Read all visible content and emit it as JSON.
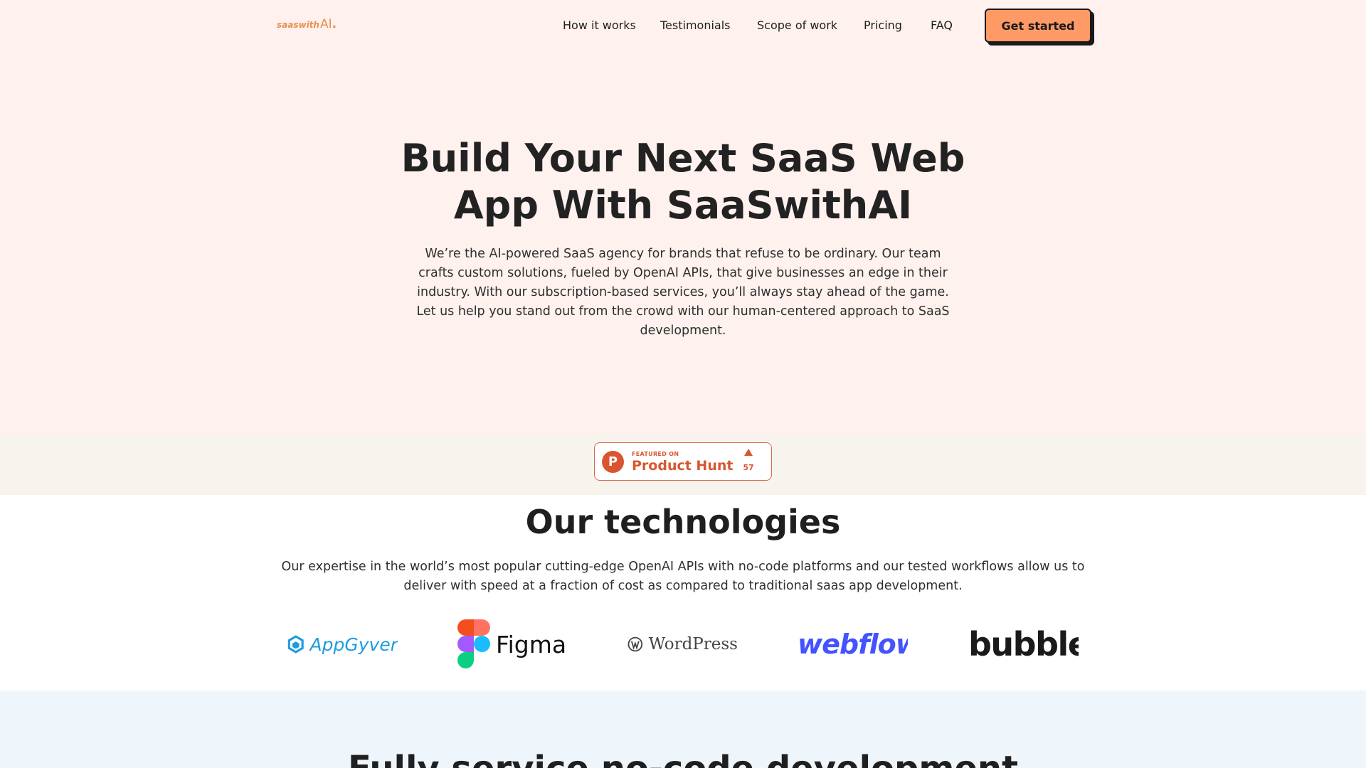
{
  "header": {
    "logo": {
      "small": "saaswith",
      "big": "AI",
      "dot": "."
    },
    "nav": [
      "How it works",
      "Testimonials",
      "Scope of work",
      "Pricing",
      "FAQ"
    ],
    "cta_label": "Get started"
  },
  "hero": {
    "title_line1": "Build Your Next SaaS Web",
    "title_line2": "App With SaaSwithAI",
    "description": "We’re the AI-powered SaaS agency for brands that refuse to be ordinary. Our team crafts custom solutions, fueled by OpenAI APIs, that give businesses an edge in their industry. With our subscription-based services, you’ll always stay ahead of the game. Let us help you stand out from the crowd with our human-centered approach to SaaS development."
  },
  "product_hunt": {
    "featured": "FEATURED ON",
    "name": "Product Hunt",
    "upvotes": "57",
    "color": "#da552f"
  },
  "technologies": {
    "title": "Our technologies",
    "description": "Our expertise in the world’s most popular cutting-edge OpenAI APIs with no-code platforms and our tested workflows allow us to deliver with speed at a fraction of cost as compared to traditional saas app development.",
    "logos": [
      "AppGyver",
      "Figma",
      "WordPress",
      "webflow",
      "bubble"
    ]
  },
  "next_section": {
    "title": "Fully service no-code development"
  },
  "colors": {
    "accent": "#ff9a66",
    "hero_bg": "#fef1ee",
    "strip_bg": "#f7f3ed",
    "next_bg": "#eef5fb"
  }
}
